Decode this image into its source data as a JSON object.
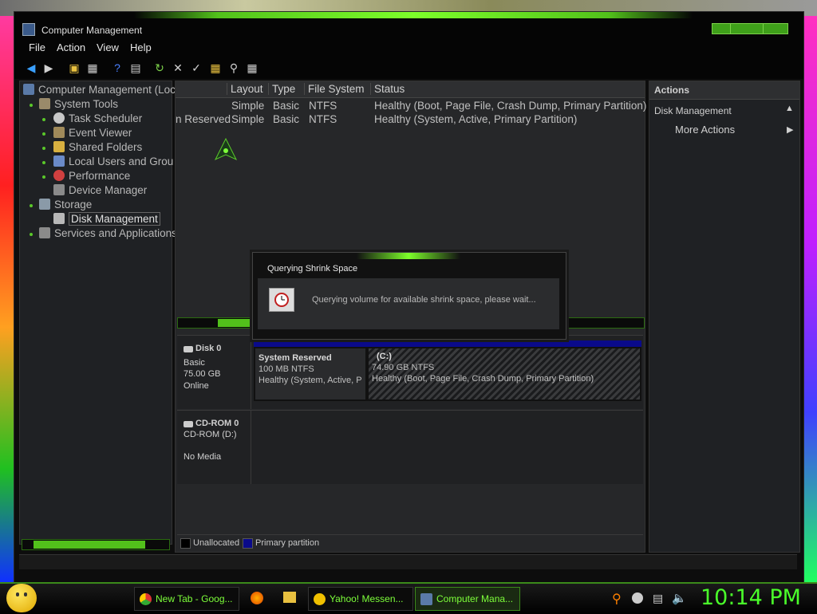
{
  "window": {
    "title": "Computer Management",
    "menus": [
      "File",
      "Action",
      "View",
      "Help"
    ]
  },
  "tree": {
    "root": "Computer Management (Loc",
    "system_tools": "System Tools",
    "task_scheduler": "Task Scheduler",
    "event_viewer": "Event Viewer",
    "shared_folders": "Shared Folders",
    "local_users": "Local Users and Grou",
    "performance": "Performance",
    "device_manager": "Device Manager",
    "storage": "Storage",
    "disk_management": "Disk Management",
    "services": "Services and Applications"
  },
  "volumes": {
    "columns": [
      "Layout",
      "Type",
      "File System",
      "Status"
    ],
    "rows": [
      {
        "name": "",
        "layout": "Simple",
        "type": "Basic",
        "fs": "NTFS",
        "status": "Healthy (Boot, Page File, Crash Dump, Primary Partition)"
      },
      {
        "name": "n Reserved",
        "layout": "Simple",
        "type": "Basic",
        "fs": "NTFS",
        "status": "Healthy (System, Active, Primary Partition)"
      }
    ]
  },
  "disks": {
    "disk0": {
      "name": "Disk 0",
      "type": "Basic",
      "size": "75.00 GB",
      "state": "Online"
    },
    "part1": {
      "title": "System Reserved",
      "size": "100 MB NTFS",
      "status": "Healthy (System, Active, P"
    },
    "part2": {
      "title": "(C:)",
      "size": "74.90 GB NTFS",
      "status": "Healthy (Boot, Page File, Crash Dump, Primary Partition)"
    },
    "cdrom": {
      "name": "CD-ROM 0",
      "drive": "CD-ROM (D:)",
      "media": "No Media"
    }
  },
  "legend": {
    "unallocated": "Unallocated",
    "primary": "Primary partition"
  },
  "actions": {
    "header": "Actions",
    "section": "Disk Management",
    "more": "More Actions"
  },
  "dialog": {
    "title": "Querying Shrink Space",
    "message": "Querying volume for available shrink space, please wait..."
  },
  "taskbar": {
    "tasks": [
      "New Tab - Goog...",
      "Yahoo! Messen...",
      "Computer Mana..."
    ],
    "clock": "10:14 PM"
  },
  "colors": {
    "accent": "#5ac82a",
    "primary_partition": "#0a0a8a"
  }
}
